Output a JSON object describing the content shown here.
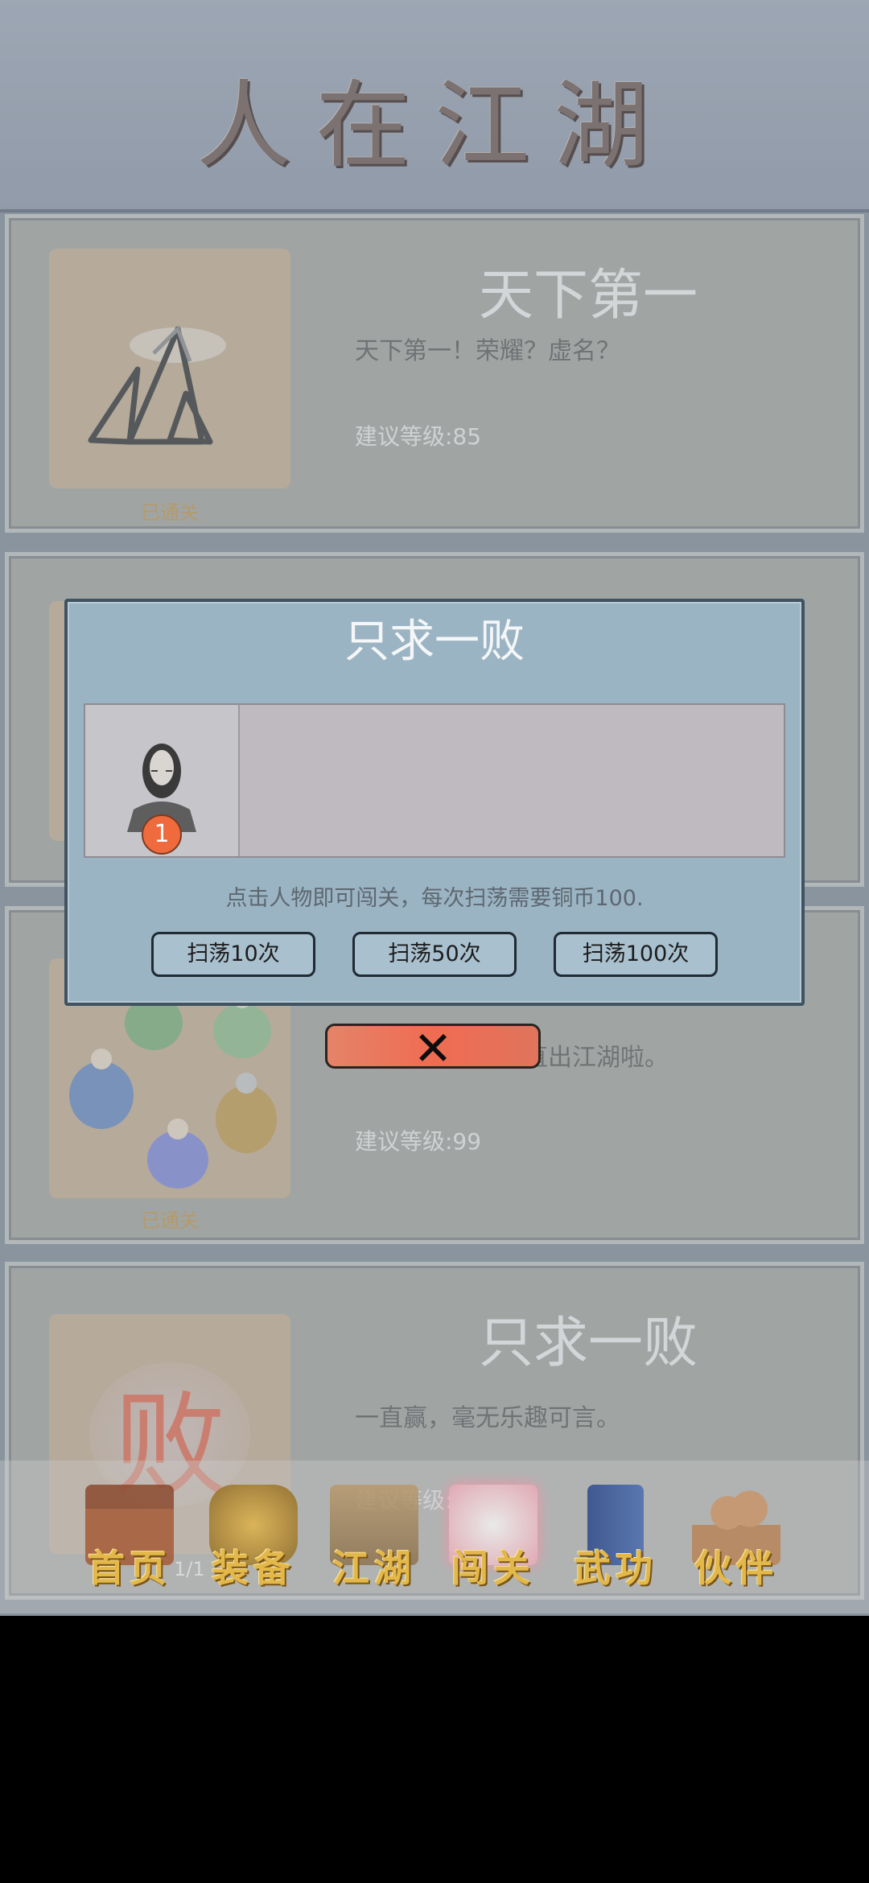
{
  "game_title": "人在江湖",
  "stages": [
    {
      "name": "天下第一",
      "desc": "天下第一！荣耀？虚名？",
      "level": "建议等级:85",
      "status": "已通关"
    },
    {
      "name": "",
      "desc": "",
      "level": "",
      "status": ""
    },
    {
      "name": "",
      "desc": "直出江湖啦。",
      "level": "建议等级:99",
      "status": "已通关"
    },
    {
      "name": "只求一败",
      "desc": "一直赢，毫无乐趣可言。",
      "level": "建议等级:",
      "status": "",
      "thumb_glyph": "败"
    }
  ],
  "dialog": {
    "title": "只求一败",
    "hero_badge": "1",
    "hint": "点击人物即可闯关，每次扫荡需要铜币100.",
    "buttons": [
      "扫荡10次",
      "扫荡50次",
      "扫荡100次"
    ],
    "close_glyph": "✕"
  },
  "page_indicator": "1/1",
  "nav": [
    {
      "label": "首页",
      "icon": "temple-icon"
    },
    {
      "label": "装备",
      "icon": "armor-icon"
    },
    {
      "label": "江湖",
      "icon": "scroll-map-icon"
    },
    {
      "label": "闯关",
      "icon": "crossed-swords-icon",
      "active": true
    },
    {
      "label": "武功",
      "icon": "book-icon"
    },
    {
      "label": "伙伴",
      "icon": "partners-icon"
    }
  ],
  "colors": {
    "accent_gold": "#e3b84a",
    "badge_orange": "#ef6a3c",
    "close_red": "#ef6c52",
    "cleared_text": "#c9a262"
  }
}
